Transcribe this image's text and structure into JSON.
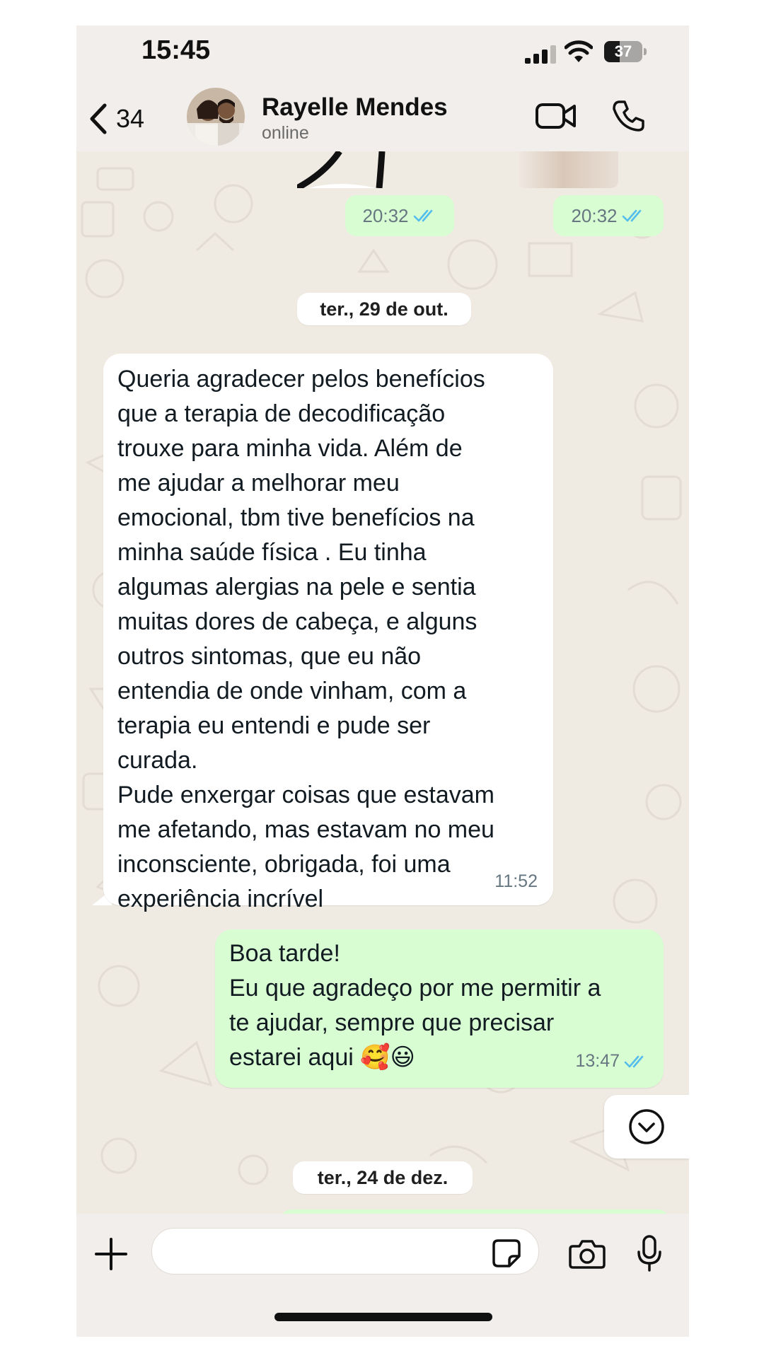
{
  "status_bar": {
    "time": "15:45",
    "battery": "37",
    "icons": [
      "signal-icon",
      "wifi-icon",
      "battery-icon"
    ]
  },
  "header": {
    "back_count": "34",
    "contact_name": "Rayelle Mendes",
    "contact_status": "online",
    "icons": [
      "chevron-left-icon",
      "video-camera-icon",
      "phone-icon"
    ]
  },
  "chat": {
    "media_stamps": [
      {
        "time": "20:32",
        "read": true
      },
      {
        "time": "20:32",
        "read": true
      }
    ],
    "date_separators": [
      "ter., 29 de out.",
      "ter., 24 de dez."
    ],
    "messages": [
      {
        "direction": "incoming",
        "text": "Queria agradecer pelos benefícios\nque a terapia de decodificação\ntrouxe para minha vida. Além de\nme ajudar a melhorar meu\nemocional, tbm tive benefícios na\nminha saúde física . Eu tinha\nalgumas alergias na pele e sentia\nmuitas dores de cabeça, e alguns\noutros sintomas, que eu não\nentendia de onde vinham, com a\nterapia eu entendi e pude ser\ncurada.\nPude enxergar coisas que estavam\nme afetando, mas estavam no meu\ninconsciente, obrigada, foi uma\nexperiência incrível",
        "time": "11:52"
      },
      {
        "direction": "outgoing",
        "text": "Boa tarde!\nEu que agradeço por me permitir a\nte ajudar, sempre que precisar\nestarei aqui 🥰😃",
        "time": "13:47",
        "read": true
      }
    ]
  },
  "input_bar": {
    "icons": [
      "plus-icon",
      "sticker-icon",
      "camera-icon",
      "microphone-icon"
    ]
  },
  "colors": {
    "chat_background": "#efeae2",
    "outgoing_bubble": "#d9fdd3",
    "incoming_bubble": "#ffffff",
    "read_ticks": "#53bdeb",
    "bar_background": "#f1eeeb"
  }
}
